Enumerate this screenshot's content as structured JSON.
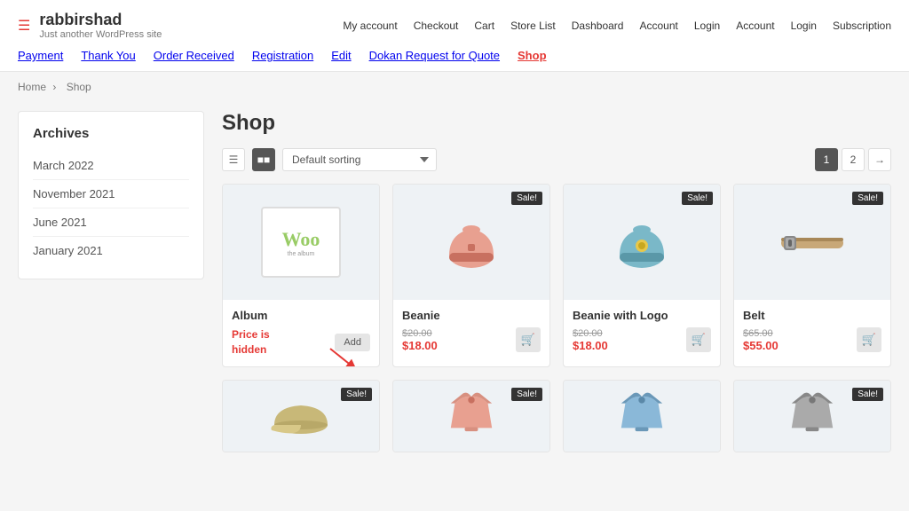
{
  "site": {
    "name": "rabbirshad",
    "tagline": "Just another WordPress site"
  },
  "nav": {
    "row1": [
      {
        "label": "My account",
        "href": "#"
      },
      {
        "label": "Checkout",
        "href": "#"
      },
      {
        "label": "Cart",
        "href": "#"
      },
      {
        "label": "Store List",
        "href": "#"
      },
      {
        "label": "Dashboard",
        "href": "#"
      },
      {
        "label": "Account",
        "href": "#"
      },
      {
        "label": "Login",
        "href": "#"
      },
      {
        "label": "Account",
        "href": "#"
      },
      {
        "label": "Login",
        "href": "#"
      },
      {
        "label": "Subscription",
        "href": "#"
      }
    ],
    "row2": [
      {
        "label": "Payment",
        "href": "#",
        "active": false
      },
      {
        "label": "Thank You",
        "href": "#",
        "active": false
      },
      {
        "label": "Order Received",
        "href": "#",
        "active": false
      },
      {
        "label": "Registration",
        "href": "#",
        "active": false
      },
      {
        "label": "Edit",
        "href": "#",
        "active": false
      },
      {
        "label": "Dokan Request for Quote",
        "href": "#",
        "active": false
      },
      {
        "label": "Shop",
        "href": "#",
        "active": true
      }
    ]
  },
  "breadcrumb": {
    "items": [
      "Home",
      "Shop"
    ]
  },
  "sidebar": {
    "title": "Archives",
    "items": [
      {
        "label": "March 2022"
      },
      {
        "label": "November 2021"
      },
      {
        "label": "June 2021"
      },
      {
        "label": "January 2021"
      }
    ]
  },
  "shop": {
    "title": "Shop",
    "sort_placeholder": "Default sorting",
    "pagination": {
      "current": 1,
      "pages": [
        "1",
        "2"
      ],
      "next": "→"
    },
    "products_row1": [
      {
        "name": "Album",
        "type": "woo",
        "sale": false,
        "price_hidden": true,
        "price_hidden_text": "Price is hidden",
        "add_label": "Add"
      },
      {
        "name": "Beanie",
        "type": "beanie_pink",
        "sale": true,
        "original_price": "$20.00",
        "sale_price": "$18.00"
      },
      {
        "name": "Beanie with Logo",
        "type": "beanie_blue",
        "sale": true,
        "original_price": "$20.00",
        "sale_price": "$18.00"
      },
      {
        "name": "Belt",
        "type": "belt",
        "sale": true,
        "original_price": "$65.00",
        "sale_price": "$55.00"
      }
    ],
    "products_row2": [
      {
        "name": "",
        "type": "cap",
        "sale": true
      },
      {
        "name": "",
        "type": "hoodie_pink",
        "sale": true
      },
      {
        "name": "",
        "type": "hoodie_blue",
        "sale": false
      },
      {
        "name": "",
        "type": "hoodie_gray",
        "sale": true
      }
    ]
  }
}
